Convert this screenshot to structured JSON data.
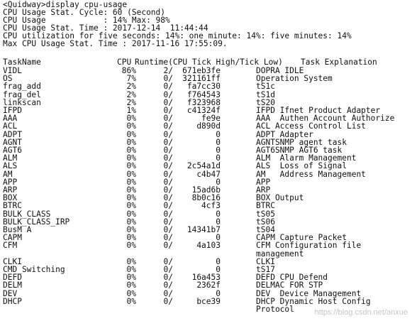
{
  "terminal": {
    "prompt": "<Quidway>display cpu-usage",
    "summary": [
      "CPU Usage Stat. Cycle: 60 (Second)",
      "CPU Usage            : 14% Max: 98%",
      "CPU Usage Stat. Time : 2017-12-14  11:44:44",
      "CPU utilization for five seconds: 14%: one minute: 14%: five minutes: 14%",
      "Max CPU Usage Stat. Time : 2017-11-16 17:55:09."
    ],
    "header": {
      "task": "TaskName",
      "cpu": "CPU",
      "runtime": "Runtime(CPU Tick High/Tick Low)",
      "explanation": "Task Explanation"
    },
    "rows": [
      {
        "name": "VIDL",
        "cpu": "86%",
        "high": "2/",
        "low": "671eb3fe",
        "exp": "DOPRA IDLE"
      },
      {
        "name": "OS",
        "cpu": "7%",
        "high": "0/",
        "low": "321161ff",
        "exp": "Operation System"
      },
      {
        "name": "frag_add",
        "cpu": "2%",
        "high": "0/",
        "low": "fa7cc30",
        "exp": "tS1c"
      },
      {
        "name": "frag_del",
        "cpu": "2%",
        "high": "0/",
        "low": "f764543",
        "exp": "tS1d"
      },
      {
        "name": "linkscan",
        "cpu": "2%",
        "high": "0/",
        "low": "f323968",
        "exp": "tS20"
      },
      {
        "name": "IFPD",
        "cpu": "1%",
        "high": "0/",
        "low": "c41324f",
        "exp": "IFPD Ifnet Product Adapter"
      },
      {
        "name": "AAA",
        "cpu": "0%",
        "high": "0/",
        "low": "fe9e",
        "exp": "AAA  Authen Account Authorize"
      },
      {
        "name": "ACL",
        "cpu": "0%",
        "high": "0/",
        "low": "d890d",
        "exp": "ACL Access Control List"
      },
      {
        "name": "ADPT",
        "cpu": "0%",
        "high": "0/",
        "low": "0",
        "exp": "ADPT Adapter"
      },
      {
        "name": "AGNT",
        "cpu": "0%",
        "high": "0/",
        "low": "0",
        "exp": "AGNTSNMP agent task"
      },
      {
        "name": "AGT6",
        "cpu": "0%",
        "high": "0/",
        "low": "0",
        "exp": "AGT6SNMP AGT6 task"
      },
      {
        "name": "ALM",
        "cpu": "0%",
        "high": "0/",
        "low": "0",
        "exp": "ALM  Alarm Management"
      },
      {
        "name": "ALS",
        "cpu": "0%",
        "high": "0/",
        "low": "2c54a1d",
        "exp": "ALS  Loss of Signal"
      },
      {
        "name": "AM",
        "cpu": "0%",
        "high": "0/",
        "low": "c4b47",
        "exp": "AM   Address Management"
      },
      {
        "name": "APP",
        "cpu": "0%",
        "high": "0/",
        "low": "0",
        "exp": "APP"
      },
      {
        "name": "ARP",
        "cpu": "0%",
        "high": "0/",
        "low": "15ad6b",
        "exp": "ARP"
      },
      {
        "name": "BOX",
        "cpu": "0%",
        "high": "0/",
        "low": "8b0c16",
        "exp": "BOX Output"
      },
      {
        "name": "BTRC",
        "cpu": "0%",
        "high": "0/",
        "low": "4cf3",
        "exp": "BTRC"
      },
      {
        "name": "BULK_CLASS",
        "cpu": "0%",
        "high": "0/",
        "low": "0",
        "exp": "tS05"
      },
      {
        "name": "BULK_CLASS_IRP",
        "cpu": "0%",
        "high": "0/",
        "low": "0",
        "exp": "tS06"
      },
      {
        "name": "BusM A",
        "cpu": "0%",
        "high": "0/",
        "low": "14341b7",
        "exp": "tS04"
      },
      {
        "name": "CAPM",
        "cpu": "0%",
        "high": "0/",
        "low": "0",
        "exp": "CAPM Capture Packet"
      },
      {
        "name": "CFM",
        "cpu": "0%",
        "high": "0/",
        "low": "4a103",
        "exp": "CFM Configuration file"
      },
      {
        "name": "",
        "cpu": "",
        "high": "",
        "low": "",
        "exp": "management"
      },
      {
        "name": "CLKI",
        "cpu": "0%",
        "high": "0/",
        "low": "0",
        "exp": "CLKI"
      },
      {
        "name": "CMD_Switching",
        "cpu": "0%",
        "high": "0/",
        "low": "0",
        "exp": "tS17"
      },
      {
        "name": "DEFD",
        "cpu": "0%",
        "high": "0/",
        "low": "16a453",
        "exp": "DEFD CPU Defend"
      },
      {
        "name": "DELM",
        "cpu": "0%",
        "high": "0/",
        "low": "2362f",
        "exp": "DELMAC FOR STP"
      },
      {
        "name": "DEV",
        "cpu": "0%",
        "high": "0/",
        "low": "0",
        "exp": "DEV  Device Management"
      },
      {
        "name": "DHCP",
        "cpu": "0%",
        "high": "0/",
        "low": "bce39",
        "exp": "DHCP Dynamic Host Config"
      },
      {
        "name": "",
        "cpu": "",
        "high": "",
        "low": "",
        "exp": "Protocol"
      }
    ]
  },
  "watermark": "https://blog.csdn.net/anxue"
}
